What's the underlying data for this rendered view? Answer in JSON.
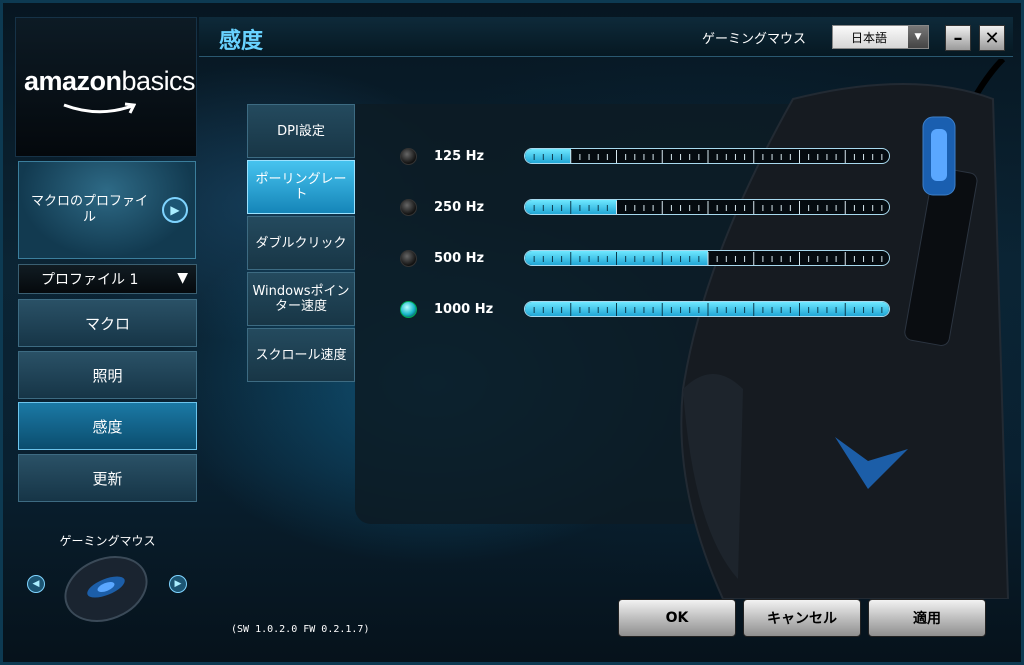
{
  "brand": {
    "logo_text_bold": "amazon",
    "logo_text_light": "basics"
  },
  "header": {
    "title": "感度",
    "device_name": "ゲーミングマウス",
    "language": "日本語"
  },
  "sidebar": {
    "macro_profile_label": "マクロのプロファイル",
    "profile_select": "プロファイル 1",
    "nav": [
      {
        "label": "マクロ",
        "active": false
      },
      {
        "label": "照明",
        "active": false
      },
      {
        "label": "感度",
        "active": true
      },
      {
        "label": "更新",
        "active": false
      }
    ],
    "device_label": "ゲーミングマウス"
  },
  "sub_tabs": [
    {
      "label": "DPI設定",
      "active": false
    },
    {
      "label": "ポーリングレート",
      "active": true
    },
    {
      "label": "ダブルクリック",
      "active": false
    },
    {
      "label": "Windowsポインター速度",
      "active": false
    },
    {
      "label": "スクロール速度",
      "active": false
    }
  ],
  "polling_rates": [
    {
      "label": "125 Hz",
      "selected": false,
      "level": 0.125
    },
    {
      "label": "250 Hz",
      "selected": false,
      "level": 0.25
    },
    {
      "label": "500 Hz",
      "selected": false,
      "level": 0.5
    },
    {
      "label": "1000 Hz",
      "selected": true,
      "level": 1.0
    }
  ],
  "footer": {
    "version": "(SW 1.0.2.0  FW 0.2.1.7)",
    "ok": "OK",
    "cancel": "キャンセル",
    "apply": "適用"
  },
  "colors": {
    "accent": "#21a7d6",
    "title": "#69d3ff",
    "active_tab": "#46c3ef"
  },
  "icons": [
    "amazon-smile-icon",
    "circle-arrow-right-icon",
    "dropdown-triangle-icon",
    "minimize-icon",
    "close-icon",
    "chevron-left-icon",
    "chevron-right-icon"
  ]
}
